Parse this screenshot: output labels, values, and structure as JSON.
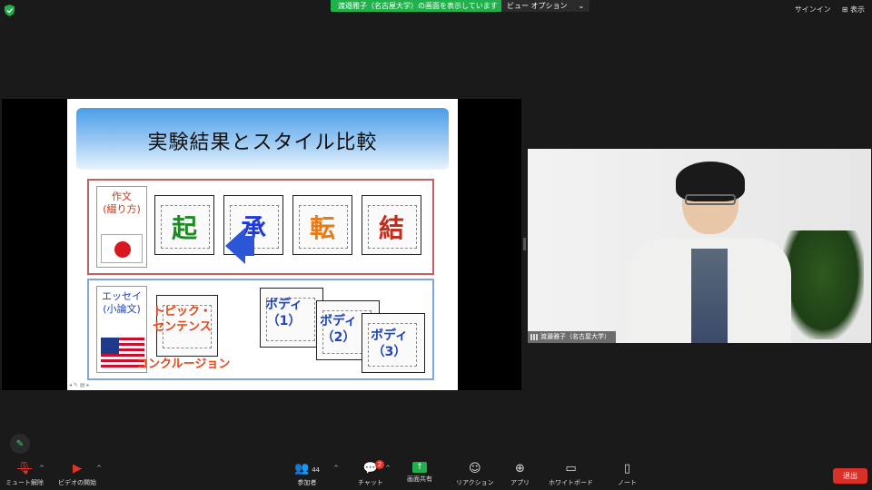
{
  "top": {
    "share_banner": "渡邉雅子（名古屋大学）の画面を表示しています",
    "view_options": "ビュー オプション",
    "view_caret": "⌄",
    "sign_in": "サインイン",
    "display": "表示"
  },
  "slide": {
    "title": "実験結果とスタイル比較",
    "row1_label": "作文\n(綴り方)",
    "row1_panels": [
      "起",
      "承",
      "転",
      "結"
    ],
    "row2_label": "エッセイ\n(小論文)",
    "topic": "トピック・\nセンテンス",
    "conclusion": "コンクルージョン",
    "bodies": [
      "ボディ\n（1）",
      "ボディ\n（2）",
      "ボディ\n（3）"
    ],
    "controls": "◂ ✎ ▤ ▸"
  },
  "participant": {
    "name": "渡邉雅子（名古屋大学）"
  },
  "toolbar": {
    "unmute": "ミュート解除",
    "video_start": "ビデオの開始",
    "participants": "参加者",
    "participants_count": "44",
    "chat": "チャット",
    "chat_badge": "2",
    "share_screen": "画面共有",
    "reactions": "リアクション",
    "apps": "アプリ",
    "whiteboard": "ホワイトボード",
    "notes": "ノート",
    "leave": "退出"
  },
  "colors": {
    "share_green": "#21b04b",
    "leave_red": "#d9302a",
    "kanji_green": "#1f8a24",
    "kanji_blue": "#1d3ad8",
    "kanji_orange": "#e87a1a",
    "kanji_red": "#c42a1a",
    "essay_blue": "#1f44b8",
    "topic_orange": "#e2461b"
  }
}
